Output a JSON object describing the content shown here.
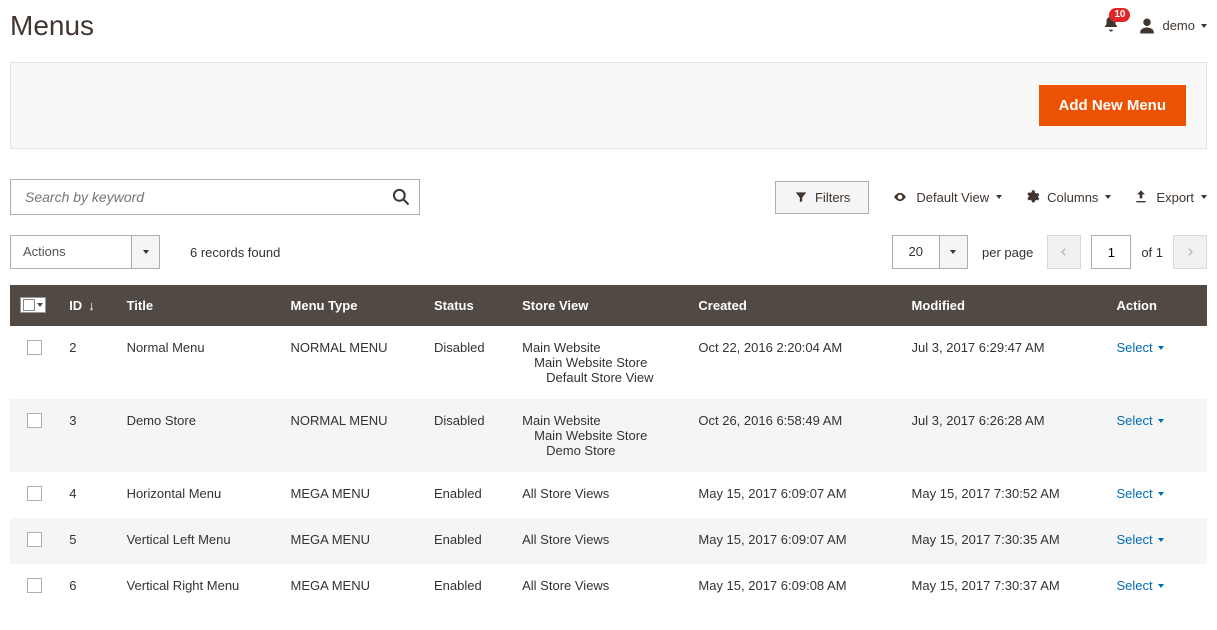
{
  "header": {
    "title": "Menus",
    "notifications": "10",
    "username": "demo"
  },
  "primary_action": {
    "label": "Add New Menu"
  },
  "search": {
    "placeholder": "Search by keyword",
    "value": ""
  },
  "toolbar": {
    "filters": "Filters",
    "default_view": "Default View",
    "columns": "Columns",
    "export": "Export"
  },
  "grid_controls": {
    "actions_label": "Actions",
    "records_found": "6 records found",
    "per_page_value": "20",
    "per_page_label": "per page",
    "current_page": "1",
    "total_pages_label": "of 1"
  },
  "columns": {
    "id": "ID",
    "title": "Title",
    "menu_type": "Menu Type",
    "status": "Status",
    "store_view": "Store View",
    "created": "Created",
    "modified": "Modified",
    "action": "Action"
  },
  "action_select_label": "Select",
  "rows": [
    {
      "id": "2",
      "title": "Normal Menu",
      "menu_type": "NORMAL MENU",
      "status": "Disabled",
      "store_l1": "Main Website",
      "store_l2": "Main Website Store",
      "store_l3": "Default Store View",
      "created": "Oct 22, 2016 2:20:04 AM",
      "modified": "Jul 3, 2017 6:29:47 AM"
    },
    {
      "id": "3",
      "title": "Demo Store",
      "menu_type": "NORMAL MENU",
      "status": "Disabled",
      "store_l1": "Main Website",
      "store_l2": "Main Website Store",
      "store_l3": "Demo Store",
      "created": "Oct 26, 2016 6:58:49 AM",
      "modified": "Jul 3, 2017 6:26:28 AM"
    },
    {
      "id": "4",
      "title": "Horizontal Menu",
      "menu_type": "MEGA MENU",
      "status": "Enabled",
      "store_l1": "All Store Views",
      "store_l2": "",
      "store_l3": "",
      "created": "May 15, 2017 6:09:07 AM",
      "modified": "May 15, 2017 7:30:52 AM"
    },
    {
      "id": "5",
      "title": "Vertical Left Menu",
      "menu_type": "MEGA MENU",
      "status": "Enabled",
      "store_l1": "All Store Views",
      "store_l2": "",
      "store_l3": "",
      "created": "May 15, 2017 6:09:07 AM",
      "modified": "May 15, 2017 7:30:35 AM"
    },
    {
      "id": "6",
      "title": "Vertical Right Menu",
      "menu_type": "MEGA MENU",
      "status": "Enabled",
      "store_l1": "All Store Views",
      "store_l2": "",
      "store_l3": "",
      "created": "May 15, 2017 6:09:08 AM",
      "modified": "May 15, 2017 7:30:37 AM"
    }
  ]
}
